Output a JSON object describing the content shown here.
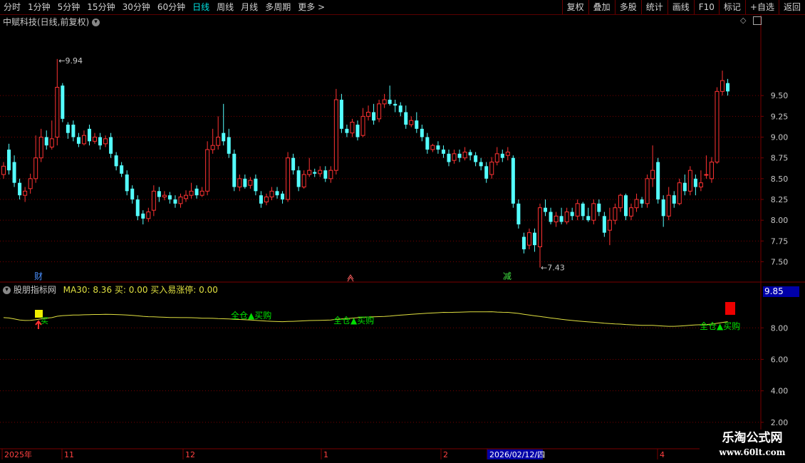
{
  "toolbar": {
    "periods": [
      {
        "label": "分时",
        "active": false
      },
      {
        "label": "1分钟",
        "active": false
      },
      {
        "label": "5分钟",
        "active": false
      },
      {
        "label": "15分钟",
        "active": false
      },
      {
        "label": "30分钟",
        "active": false
      },
      {
        "label": "60分钟",
        "active": false
      },
      {
        "label": "日线",
        "active": true
      },
      {
        "label": "周线",
        "active": false
      },
      {
        "label": "月线",
        "active": false
      },
      {
        "label": "多周期",
        "active": false
      },
      {
        "label": "更多 >",
        "active": false
      }
    ],
    "right_buttons": [
      "复权",
      "叠加",
      "多股",
      "统计",
      "画线",
      "F10",
      "标记",
      "+自选",
      "返回"
    ]
  },
  "main_title": "中赋科技(日线,前复权)",
  "indicator_title": "股朋指标网",
  "indicator_values": "MA30: 8.36  买: 0.00  买入易涨停: 0.00",
  "indicator_current": "9.85",
  "date_axis": [
    {
      "label": "2025年"
    },
    {
      "label": "11"
    },
    {
      "label": "12"
    },
    {
      "label": "1"
    },
    {
      "label": "2"
    },
    {
      "label": "2026/02/12/四",
      "highlight": true
    },
    {
      "label": "4"
    }
  ],
  "markers": {
    "cai": "财",
    "jian": "减"
  },
  "signals": [
    "全仓▲买购",
    "全仓▲买购",
    "全仓▲买购"
  ],
  "signal_buy": "买",
  "watermark": {
    "line1": "乐淘公式网",
    "line2": "www.60lt.com"
  },
  "colors": {
    "up": "#ff3232",
    "down": "#54ffff",
    "ma": "#e0e040",
    "grid": "#7a0000",
    "signal": "#00e000"
  },
  "chart_data": {
    "type": "candlestick",
    "title": "中赋科技(日线,前复权)",
    "ylim": [
      7.35,
      10.35
    ],
    "y_ticks": [
      7.5,
      7.75,
      8.0,
      8.25,
      8.5,
      8.75,
      9.0,
      9.25,
      9.5
    ],
    "high_label": "9.94",
    "low_label": "7.43",
    "candles": [
      [
        8.55,
        8.65,
        8.7,
        8.5
      ],
      [
        8.85,
        8.6,
        8.92,
        8.55
      ],
      [
        8.7,
        8.45,
        8.78,
        8.4
      ],
      [
        8.45,
        8.3,
        8.5,
        8.25
      ],
      [
        8.3,
        8.35,
        8.4,
        8.22
      ],
      [
        8.38,
        8.5,
        8.56,
        8.32
      ],
      [
        8.5,
        8.75,
        9.02,
        8.45
      ],
      [
        8.75,
        9.0,
        9.1,
        8.7
      ],
      [
        9.0,
        8.9,
        9.08,
        8.85
      ],
      [
        8.88,
        8.98,
        9.2,
        8.85
      ],
      [
        9.0,
        9.6,
        9.94,
        8.9
      ],
      [
        9.62,
        9.22,
        9.65,
        9.18
      ],
      [
        9.15,
        9.05,
        9.18,
        8.98
      ],
      [
        9.15,
        9.0,
        9.2,
        8.95
      ],
      [
        9.0,
        8.92,
        9.05,
        8.88
      ],
      [
        8.92,
        9.02,
        9.08,
        8.9
      ],
      [
        9.1,
        8.95,
        9.15,
        8.9
      ],
      [
        8.95,
        9.0,
        9.05,
        8.92
      ],
      [
        9.0,
        8.9,
        9.05,
        8.85
      ],
      [
        8.92,
        8.98,
        9.02,
        8.88
      ],
      [
        9.0,
        8.8,
        9.05,
        8.75
      ],
      [
        8.78,
        8.65,
        8.82,
        8.6
      ],
      [
        8.66,
        8.56,
        8.7,
        8.52
      ],
      [
        8.55,
        8.35,
        8.6,
        8.3
      ],
      [
        8.38,
        8.25,
        8.42,
        8.2
      ],
      [
        8.25,
        8.05,
        8.3,
        8.0
      ],
      [
        8.08,
        8.02,
        8.12,
        7.95
      ],
      [
        8.02,
        8.1,
        8.15,
        7.98
      ],
      [
        8.12,
        8.35,
        8.42,
        8.05
      ],
      [
        8.35,
        8.28,
        8.4,
        8.22
      ],
      [
        8.28,
        8.3,
        8.35,
        8.24
      ],
      [
        8.3,
        8.25,
        8.34,
        8.2
      ],
      [
        8.25,
        8.2,
        8.3,
        8.15
      ],
      [
        8.2,
        8.28,
        8.32,
        8.15
      ],
      [
        8.26,
        8.3,
        8.36,
        8.22
      ],
      [
        8.3,
        8.35,
        8.45,
        8.26
      ],
      [
        8.38,
        8.3,
        8.42,
        8.26
      ],
      [
        8.3,
        8.35,
        8.4,
        8.28
      ],
      [
        8.35,
        8.85,
        8.95,
        8.3
      ],
      [
        8.85,
        8.9,
        9.1,
        8.8
      ],
      [
        8.9,
        9.0,
        9.25,
        8.85
      ],
      [
        9.05,
        8.95,
        9.4,
        8.9
      ],
      [
        9.0,
        8.8,
        9.1,
        8.75
      ],
      [
        8.8,
        8.4,
        8.85,
        8.35
      ],
      [
        8.4,
        8.5,
        8.55,
        8.35
      ],
      [
        8.5,
        8.4,
        8.55,
        8.38
      ],
      [
        8.42,
        8.48,
        8.52,
        8.38
      ],
      [
        8.5,
        8.35,
        8.55,
        8.3
      ],
      [
        8.3,
        8.2,
        8.35,
        8.15
      ],
      [
        8.22,
        8.28,
        8.32,
        8.18
      ],
      [
        8.28,
        8.35,
        8.4,
        8.24
      ],
      [
        8.35,
        8.3,
        8.4,
        8.26
      ],
      [
        8.32,
        8.25,
        8.35,
        8.2
      ],
      [
        8.25,
        8.75,
        8.82,
        8.22
      ],
      [
        8.75,
        8.6,
        8.8,
        8.55
      ],
      [
        8.6,
        8.4,
        8.65,
        8.35
      ],
      [
        8.4,
        8.55,
        8.6,
        8.38
      ],
      [
        8.55,
        8.6,
        8.75,
        8.52
      ],
      [
        8.58,
        8.56,
        8.62,
        8.52
      ],
      [
        8.56,
        8.6,
        8.65,
        8.52
      ],
      [
        8.6,
        8.5,
        8.65,
        8.46
      ],
      [
        8.5,
        8.6,
        8.65,
        8.45
      ],
      [
        8.6,
        9.45,
        9.58,
        8.55
      ],
      [
        9.45,
        9.1,
        9.52,
        9.05
      ],
      [
        9.1,
        9.05,
        9.15,
        9.0
      ],
      [
        9.05,
        9.18,
        9.22,
        9.0
      ],
      [
        9.15,
        9.0,
        9.2,
        8.96
      ],
      [
        9.02,
        9.25,
        9.35,
        9.0
      ],
      [
        9.25,
        9.3,
        9.38,
        9.2
      ],
      [
        9.3,
        9.2,
        9.4,
        9.15
      ],
      [
        9.22,
        9.4,
        9.45,
        9.18
      ],
      [
        9.4,
        9.45,
        9.52,
        9.35
      ],
      [
        9.45,
        9.4,
        9.62,
        9.38
      ],
      [
        9.4,
        9.38,
        9.45,
        9.3
      ],
      [
        9.38,
        9.3,
        9.42,
        9.25
      ],
      [
        9.3,
        9.15,
        9.38,
        9.1
      ],
      [
        9.15,
        9.2,
        9.25,
        9.12
      ],
      [
        9.2,
        9.1,
        9.3,
        9.05
      ],
      [
        9.1,
        9.0,
        9.15,
        8.95
      ],
      [
        9.0,
        8.85,
        9.05,
        8.8
      ],
      [
        8.85,
        8.9,
        8.92,
        8.82
      ],
      [
        8.9,
        8.85,
        8.95,
        8.8
      ],
      [
        8.85,
        8.8,
        8.9,
        8.75
      ],
      [
        8.8,
        8.7,
        8.85,
        8.65
      ],
      [
        8.72,
        8.8,
        8.85,
        8.68
      ],
      [
        8.8,
        8.75,
        8.85,
        8.7
      ],
      [
        8.75,
        8.82,
        8.88,
        8.72
      ],
      [
        8.82,
        8.78,
        8.85,
        8.72
      ],
      [
        8.78,
        8.7,
        8.82,
        8.65
      ],
      [
        8.7,
        8.65,
        8.75,
        8.6
      ],
      [
        8.65,
        8.5,
        8.7,
        8.45
      ],
      [
        8.55,
        8.7,
        8.76,
        8.5
      ],
      [
        8.7,
        8.8,
        8.88,
        8.66
      ],
      [
        8.8,
        8.75,
        8.85,
        8.7
      ],
      [
        8.78,
        8.82,
        8.88,
        8.72
      ],
      [
        8.75,
        8.2,
        8.78,
        8.15
      ],
      [
        8.2,
        7.95,
        8.25,
        7.9
      ],
      [
        7.8,
        7.65,
        7.85,
        7.6
      ],
      [
        7.7,
        7.85,
        7.9,
        7.65
      ],
      [
        7.85,
        7.7,
        7.9,
        7.62
      ],
      [
        7.68,
        8.15,
        8.2,
        7.43
      ],
      [
        8.15,
        8.1,
        8.25,
        8.05
      ],
      [
        8.1,
        7.98,
        8.15,
        7.95
      ],
      [
        7.98,
        8.05,
        8.1,
        7.92
      ],
      [
        8.05,
        7.98,
        8.15,
        7.95
      ],
      [
        7.98,
        8.1,
        8.15,
        7.95
      ],
      [
        8.1,
        8.05,
        8.15,
        8.0
      ],
      [
        8.05,
        8.2,
        8.25,
        8.0
      ],
      [
        8.2,
        8.05,
        8.22,
        8.0
      ],
      [
        8.05,
        8.0,
        8.15,
        7.98
      ],
      [
        8.0,
        8.2,
        8.25,
        7.95
      ],
      [
        8.2,
        8.1,
        8.25,
        8.05
      ],
      [
        8.05,
        7.85,
        8.1,
        7.8
      ],
      [
        7.88,
        8.0,
        8.15,
        7.7
      ],
      [
        8.0,
        8.15,
        8.2,
        7.95
      ],
      [
        8.15,
        8.3,
        8.32,
        8.1
      ],
      [
        8.3,
        8.05,
        8.32,
        8.0
      ],
      [
        8.05,
        8.15,
        8.2,
        8.0
      ],
      [
        8.15,
        8.25,
        8.32,
        8.1
      ],
      [
        8.25,
        8.2,
        8.28,
        8.15
      ],
      [
        8.2,
        8.5,
        8.55,
        8.15
      ],
      [
        8.5,
        8.6,
        8.9,
        8.4
      ],
      [
        8.7,
        8.25,
        8.75,
        8.2
      ],
      [
        8.25,
        8.05,
        8.3,
        7.92
      ],
      [
        8.05,
        8.3,
        8.4,
        8.0
      ],
      [
        8.3,
        8.2,
        8.35,
        8.15
      ],
      [
        8.2,
        8.45,
        8.5,
        8.18
      ],
      [
        8.45,
        8.35,
        8.55,
        8.3
      ],
      [
        8.35,
        8.6,
        8.65,
        8.3
      ],
      [
        8.5,
        8.4,
        8.55,
        8.3
      ],
      [
        8.4,
        8.45,
        8.6,
        8.35
      ],
      [
        8.55,
        8.55,
        8.78,
        8.5
      ],
      [
        8.5,
        8.7,
        8.76,
        8.45
      ],
      [
        8.7,
        9.55,
        9.6,
        8.68
      ],
      [
        9.55,
        9.68,
        9.8,
        9.5
      ],
      [
        9.65,
        9.55,
        9.7,
        9.5
      ]
    ]
  }
}
